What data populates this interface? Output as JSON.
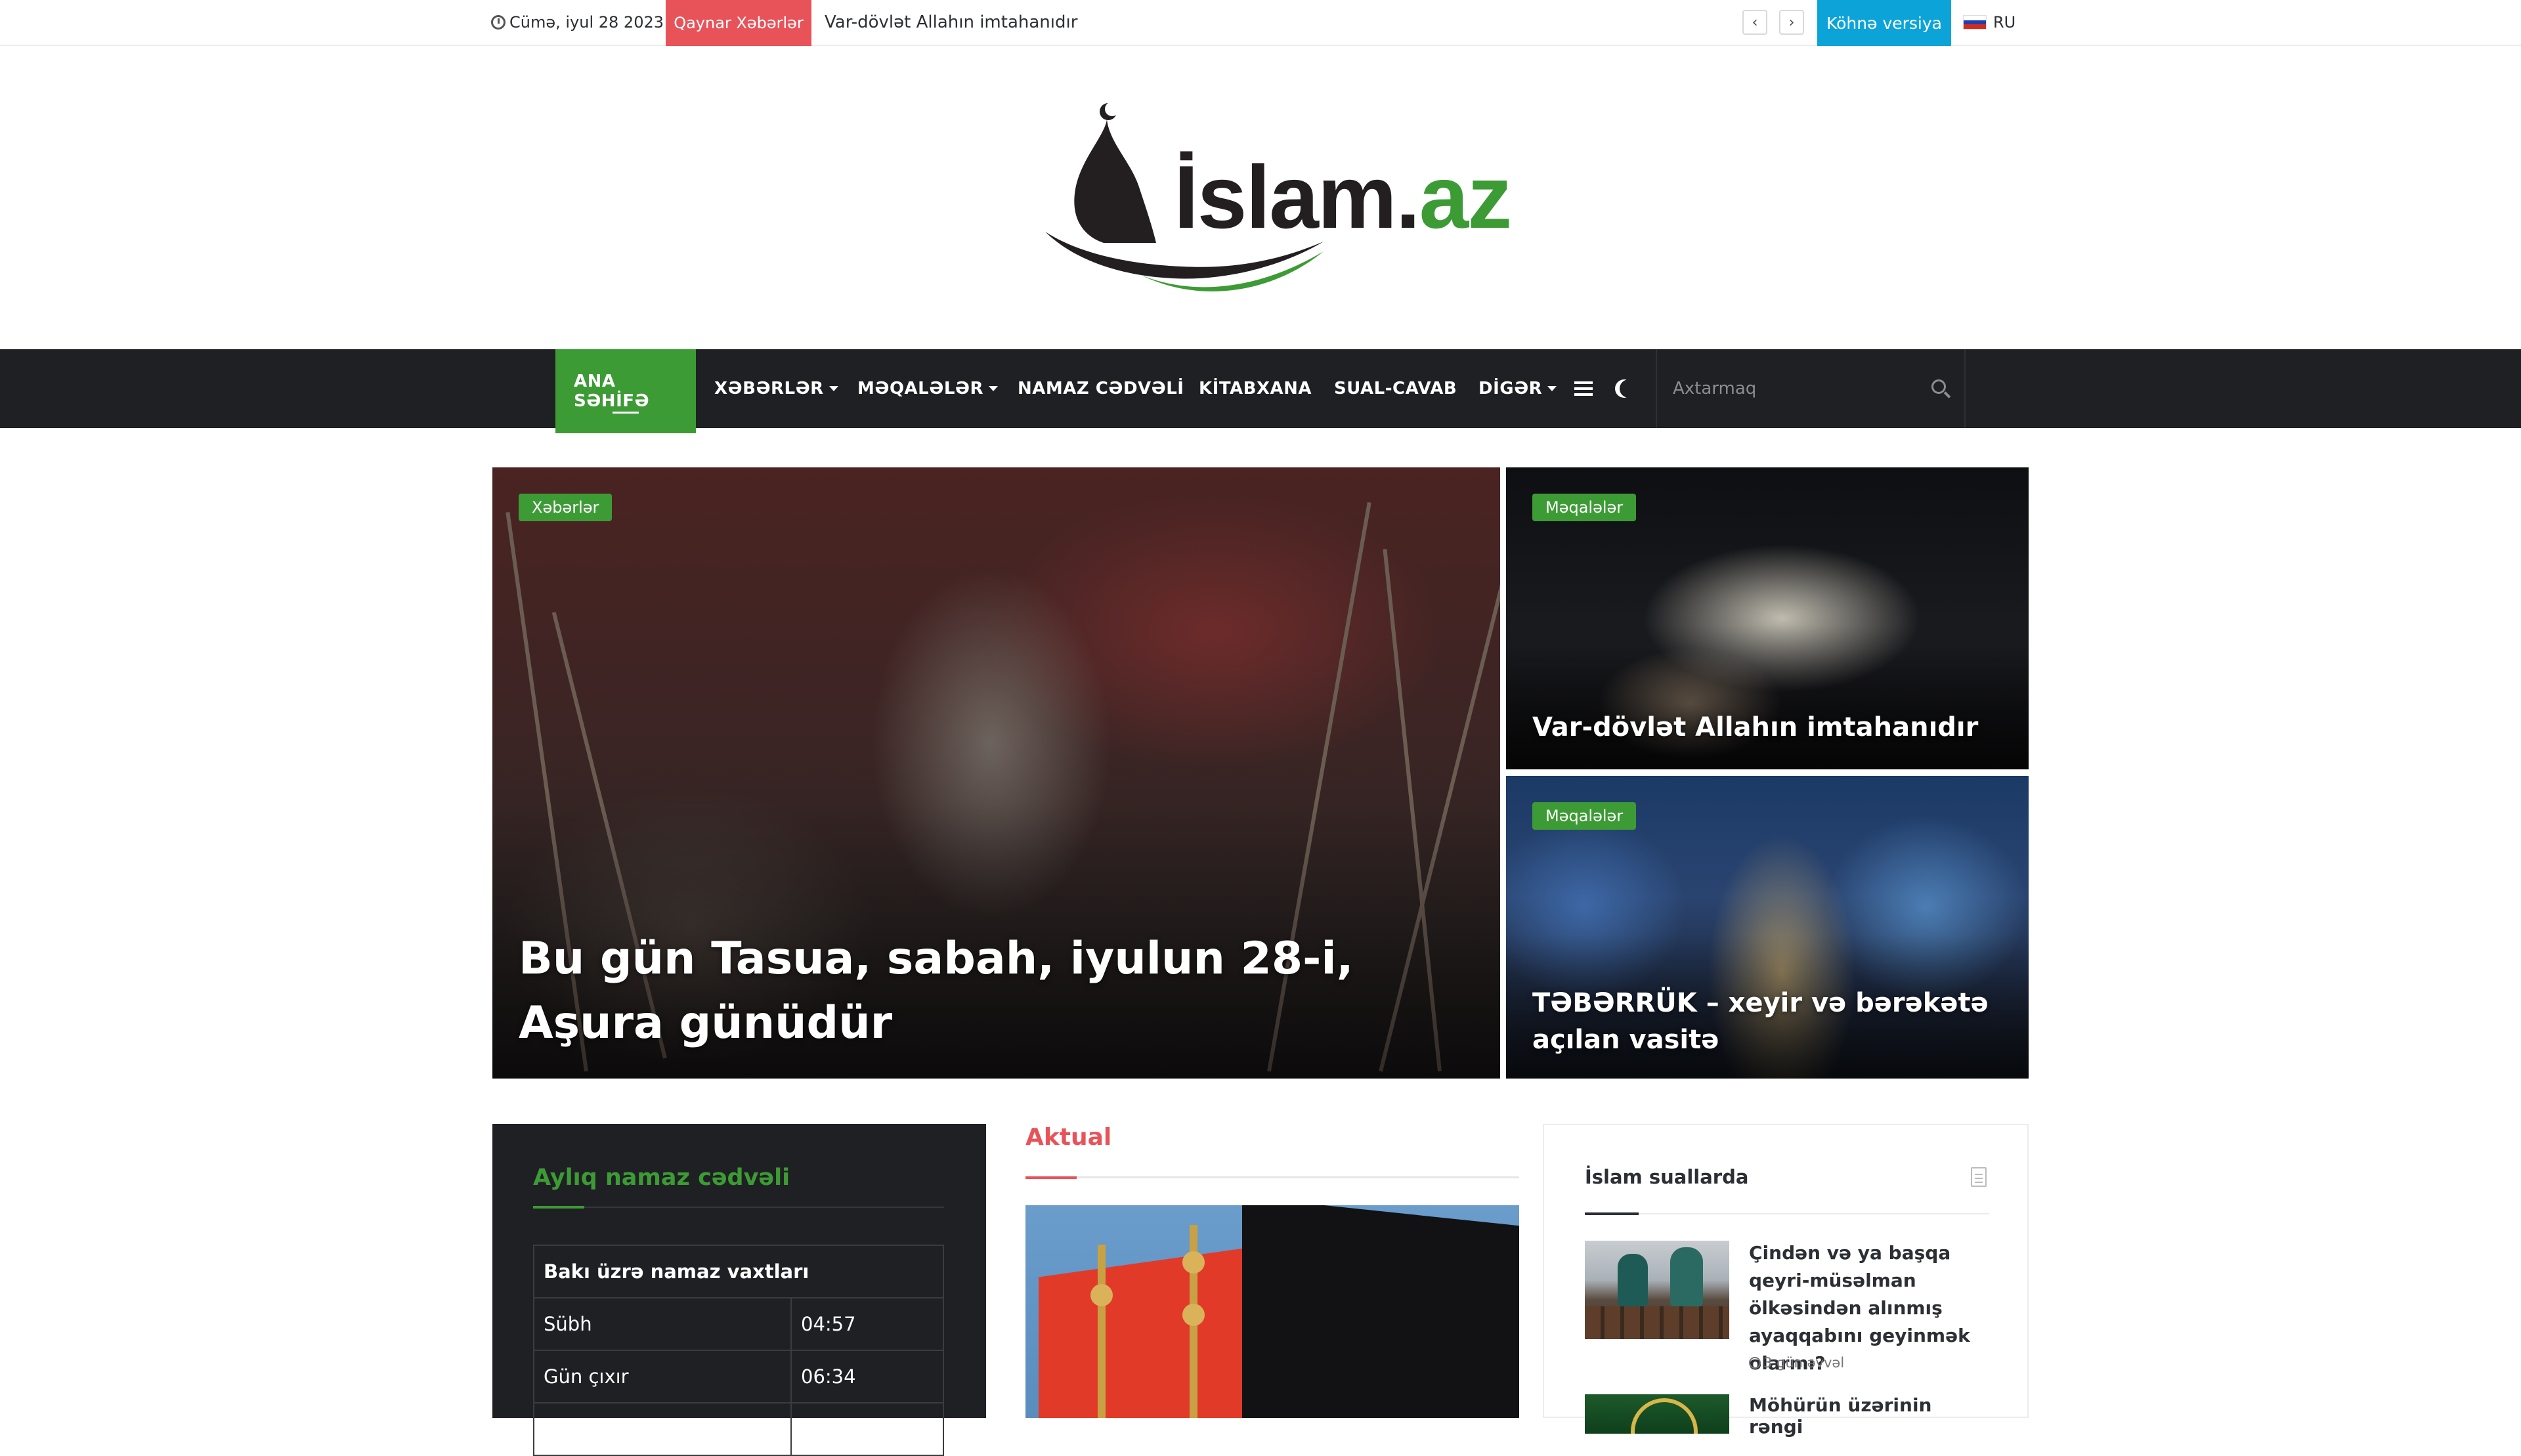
{
  "topbar": {
    "date": "Cümə, iyul 28 2023",
    "hot_label": "Qaynar Xəbərlər",
    "ticker": "Var-dövlət Allahın imtahanıdır",
    "prev_icon": "chevron-left-icon",
    "next_icon": "chevron-right-icon",
    "prev_glyph": "‹",
    "next_glyph": "›",
    "old_version": "Köhnə versiya",
    "lang": "RU",
    "colors": {
      "hot": "#e8535a",
      "old_version": "#0ca4d8"
    }
  },
  "logo": {
    "main": "İslam.",
    "tld": "az",
    "brand_green": "#3d9b35"
  },
  "nav": {
    "items": [
      {
        "label": "ANA SƏHİFƏ",
        "active": true
      },
      {
        "label": "XƏBƏRLƏR",
        "dropdown": true
      },
      {
        "label": "MƏQALƏLƏR",
        "dropdown": true
      },
      {
        "label": "NAMAZ CƏDVƏLİ"
      },
      {
        "label": "KİTABXANA"
      },
      {
        "label": "SUAL-CAVAB"
      },
      {
        "label": "DİGƏR",
        "dropdown": true
      }
    ],
    "search_placeholder": "Axtarmaq",
    "background": "#1f2024"
  },
  "featured": {
    "main": {
      "category": "Xəbərlər",
      "title": "Bu gün Tasua, sabah, iyulun 28-i, Aşura günüdür"
    },
    "side": [
      {
        "category": "Məqalələr",
        "title": "Var-dövlət Allahın imtahanıdır"
      },
      {
        "category": "Məqalələr",
        "title": "TƏBƏRRÜK – xeyir və bərəkətə açılan vasitə"
      }
    ]
  },
  "prayer_widget": {
    "title": "Aylıq namaz cədvəli",
    "table_header": "Bakı üzrə namaz vaxtları",
    "rows": [
      {
        "name": "Sübh",
        "time": "04:57"
      },
      {
        "name": "Gün çıxır",
        "time": "06:34"
      }
    ]
  },
  "aktual": {
    "title": "Aktual"
  },
  "qa_widget": {
    "title": "İslam suallarda",
    "items": [
      {
        "question": "Çindən və ya başqa qeyri-müsəlman ölkəsindən alınmış ayaqqabını geyinmək olarmı?",
        "time": "3 gün əvvəl"
      },
      {
        "question": "Möhürün üzərinin rəngi"
      }
    ]
  }
}
